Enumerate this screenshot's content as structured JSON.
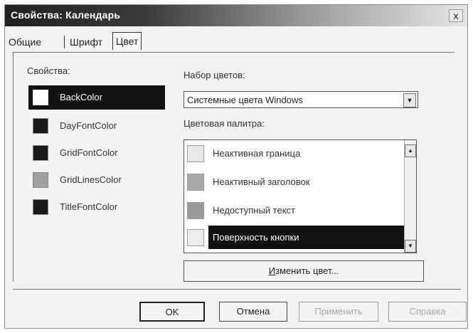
{
  "window": {
    "title": "Свойства: Календарь",
    "close_label": "x"
  },
  "tabs": [
    {
      "label": "Общие"
    },
    {
      "label": "Шрифт"
    },
    {
      "label": "Цвет"
    }
  ],
  "properties": {
    "label": "Свойства:",
    "items": [
      {
        "name": "BackColor",
        "color": "#ffffff"
      },
      {
        "name": "DayFontColor",
        "color": "#1a1a1a"
      },
      {
        "name": "GridFontColor",
        "color": "#1a1a1a"
      },
      {
        "name": "GridLinesColor",
        "color": "#a0a0a0"
      },
      {
        "name": "TitleFontColor",
        "color": "#1a1a1a"
      }
    ]
  },
  "color_set": {
    "label": "Набор цветов:",
    "value": "Системные цвета Windows"
  },
  "palette": {
    "label": "Цветовая палитра:",
    "items": [
      {
        "name": "Неактивная граница",
        "color": "#e8e8e8"
      },
      {
        "name": "Неактивный заголовок",
        "color": "#a8a8a8"
      },
      {
        "name": "Недоступный текст",
        "color": "#9a9a9a"
      },
      {
        "name": "Поверхность кнопки",
        "color": "#ededed"
      }
    ]
  },
  "change_button": {
    "underlined": "И",
    "rest": "зменить цвет..."
  },
  "buttons": {
    "ok": "OK",
    "cancel": "Отмена",
    "apply": "Применить",
    "help": "Справка"
  }
}
